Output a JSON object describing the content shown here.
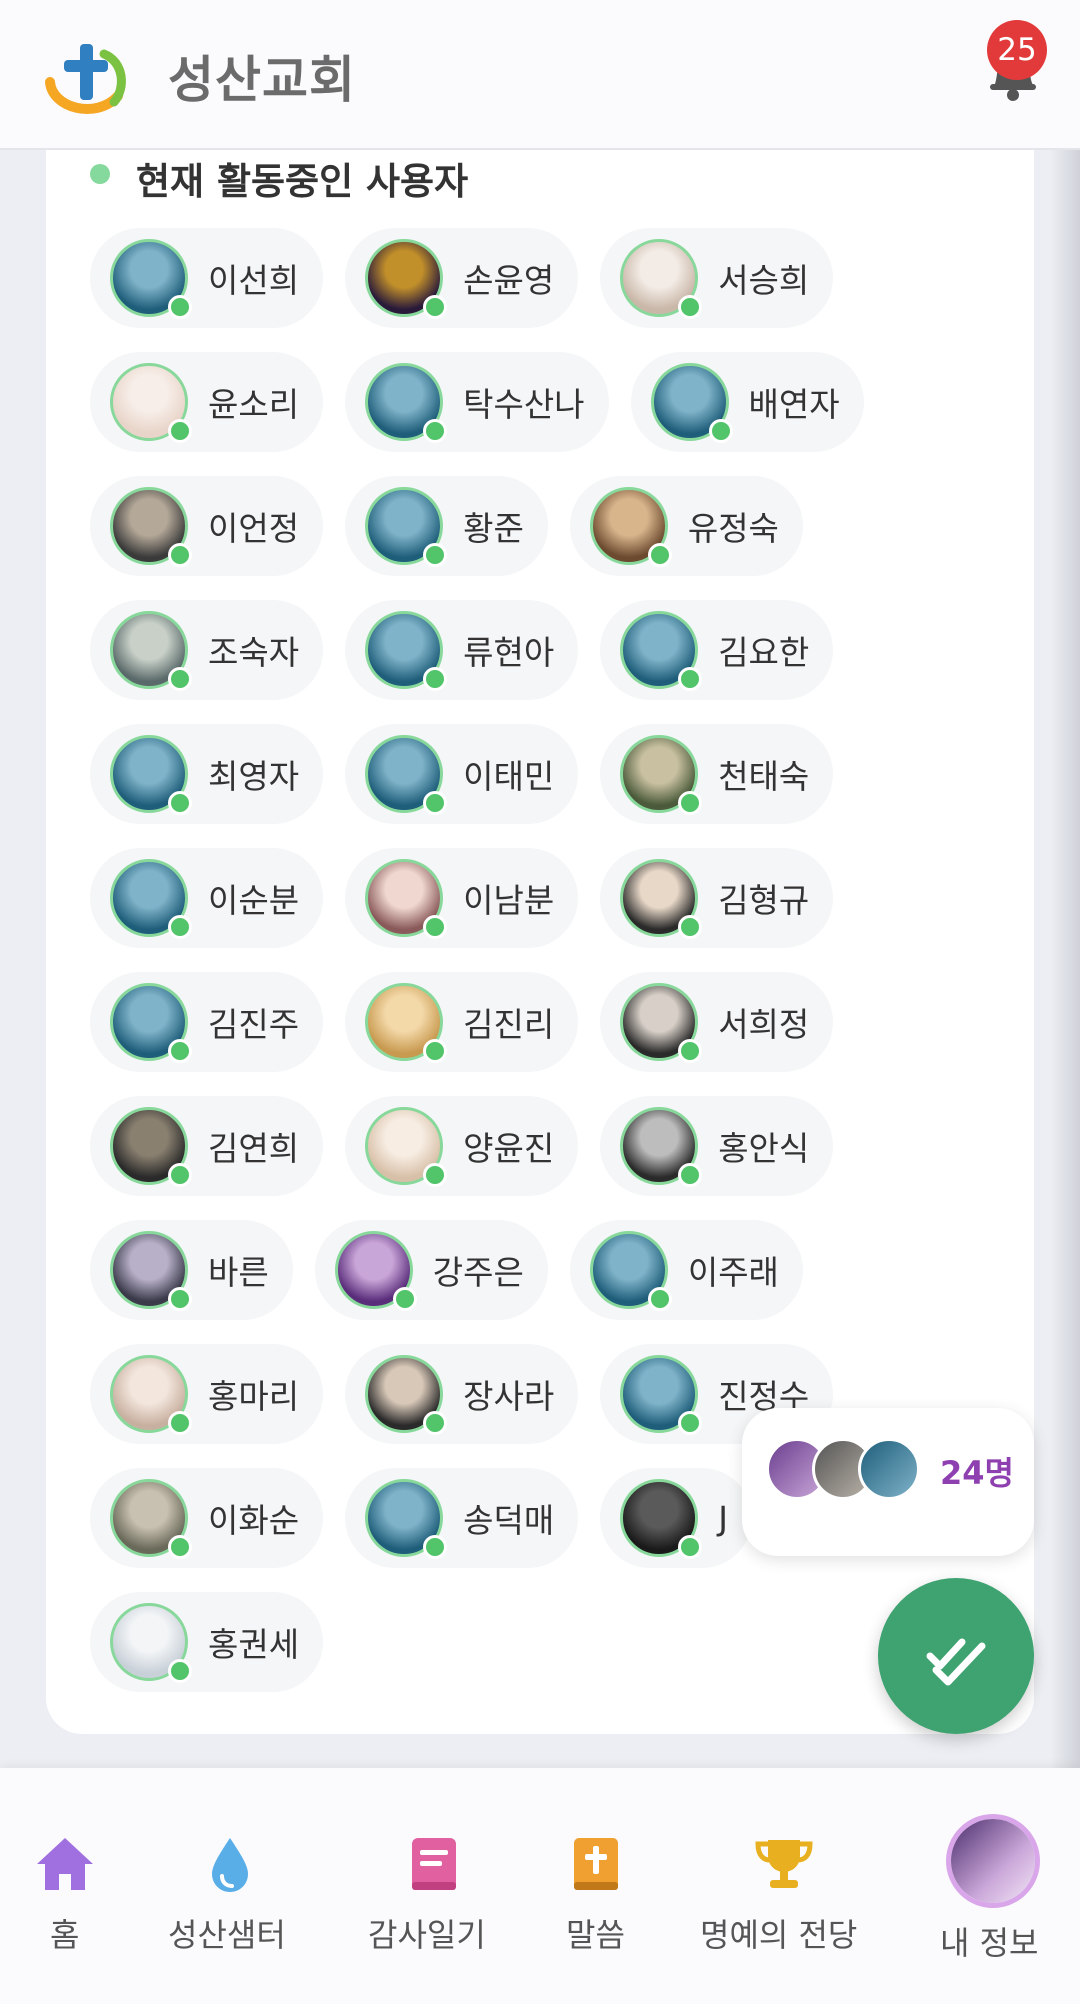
{
  "header": {
    "title": "성산교회",
    "notification_count": "25"
  },
  "section": {
    "title": "현재 활동중인 사용자"
  },
  "users": [
    [
      "이선희",
      "손윤영",
      "서승희"
    ],
    [
      "윤소리",
      "탁수산나",
      "배연자"
    ],
    [
      "이언정",
      "황준",
      "유정숙"
    ],
    [
      "조숙자",
      "류현아",
      "김요한"
    ],
    [
      "최영자",
      "이태민",
      "천태숙"
    ],
    [
      "이순분",
      "이남분",
      "김형규"
    ],
    [
      "김진주",
      "김진리",
      "서희정"
    ],
    [
      "김연희",
      "양윤진",
      "홍안식"
    ],
    [
      "바른",
      "강주은",
      "이주래"
    ],
    [
      "홍마리",
      "장사라",
      "진정수"
    ],
    [
      "이화순",
      "송덕매",
      "J"
    ],
    [
      "홍권세"
    ]
  ],
  "online_summary": {
    "count_label": "24명"
  },
  "fab": {
    "icon": "double-check-icon"
  },
  "nav": {
    "items": [
      {
        "label": "홈",
        "icon": "home-icon",
        "color": "#a070e0"
      },
      {
        "label": "성산샘터",
        "icon": "water-drop-icon",
        "color": "#5aaee8"
      },
      {
        "label": "감사일기",
        "icon": "book-icon",
        "color": "#e060a0"
      },
      {
        "label": "말씀",
        "icon": "bible-icon",
        "color": "#f0a030"
      },
      {
        "label": "명예의 전당",
        "icon": "trophy-icon",
        "color": "#e8b020"
      },
      {
        "label": "내 정보",
        "icon": "profile-avatar"
      }
    ]
  },
  "colors": {
    "accent": "#3fa371",
    "badge": "#e23a3a",
    "online": "#52c46a",
    "count": "#8e3fb0"
  }
}
